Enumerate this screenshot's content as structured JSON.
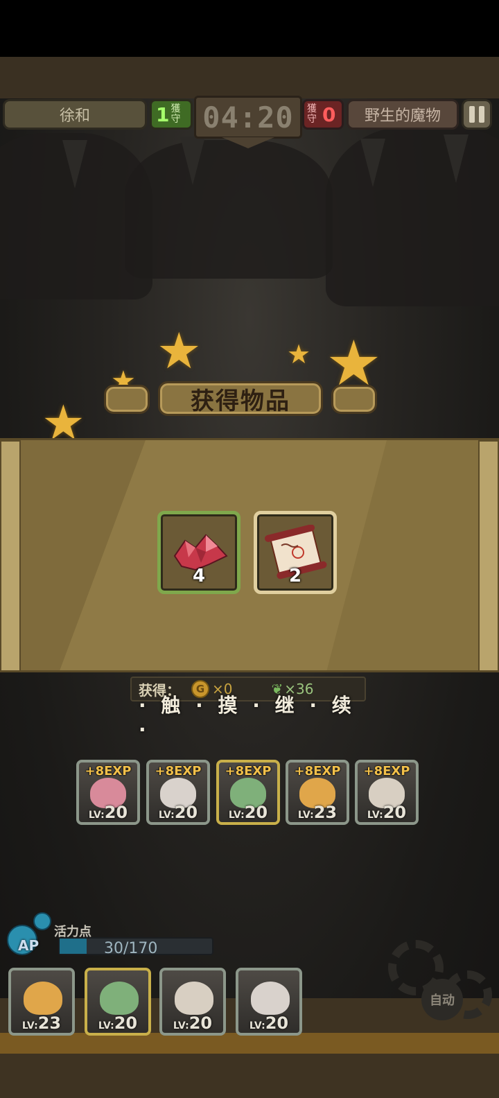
{
  "hud": {
    "left_team": "徐和",
    "left_score": "1",
    "left_score_label": "獲守",
    "timer": "04:20",
    "right_score": "0",
    "right_score_label": "獲守",
    "right_team": "野生的魔物",
    "pause_icon": "pause-icon"
  },
  "result": {
    "title": "获得物品",
    "items": [
      {
        "icon": "red-crystal-icon",
        "count": "4",
        "frame": "green"
      },
      {
        "icon": "scroll-icon",
        "count": "2",
        "frame": "cream"
      }
    ],
    "rewards_label": "获得：",
    "gold_icon": "gold-coin-icon",
    "gold_value": "×0",
    "feather_icon": "feather-icon",
    "feather_value": "×36",
    "continue_text": "· 触 · 摸 · 继 · 续 ·"
  },
  "exp_cards": [
    {
      "exp": "+8EXP",
      "lv_prefix": "LV:",
      "lv": "20",
      "frame": "silver",
      "face_color": "#d88a9a"
    },
    {
      "exp": "+8EXP",
      "lv_prefix": "LV:",
      "lv": "20",
      "frame": "silver",
      "face_color": "#d9d2cc"
    },
    {
      "exp": "+8EXP",
      "lv_prefix": "LV:",
      "lv": "20",
      "frame": "gold",
      "face_color": "#7fb07a"
    },
    {
      "exp": "+8EXP",
      "lv_prefix": "LV:",
      "lv": "23",
      "frame": "silver",
      "face_color": "#e0a64a"
    },
    {
      "exp": "+8EXP",
      "lv_prefix": "LV:",
      "lv": "20",
      "frame": "silver",
      "face_color": "#d8cfc2"
    }
  ],
  "ap": {
    "title": "活力点",
    "label": "AP",
    "value_text": "30/170",
    "current": 30,
    "max": 170
  },
  "party": [
    {
      "lv_prefix": "LV:",
      "lv": "23",
      "frame": "silver",
      "face_color": "#e0a64a"
    },
    {
      "lv_prefix": "LV:",
      "lv": "20",
      "frame": "gold",
      "face_color": "#7fb07a"
    },
    {
      "lv_prefix": "LV:",
      "lv": "20",
      "frame": "silver",
      "face_color": "#d8cfc2"
    },
    {
      "lv_prefix": "LV:",
      "lv": "20",
      "frame": "silver",
      "face_color": "#d9d2cc"
    }
  ],
  "auto_button": "自动",
  "colors": {
    "accent_gold": "#e9b43c",
    "left_team_green": "#a6ff6c",
    "right_team_red": "#ff5d5d",
    "ap_blue": "#1f6f8a"
  }
}
